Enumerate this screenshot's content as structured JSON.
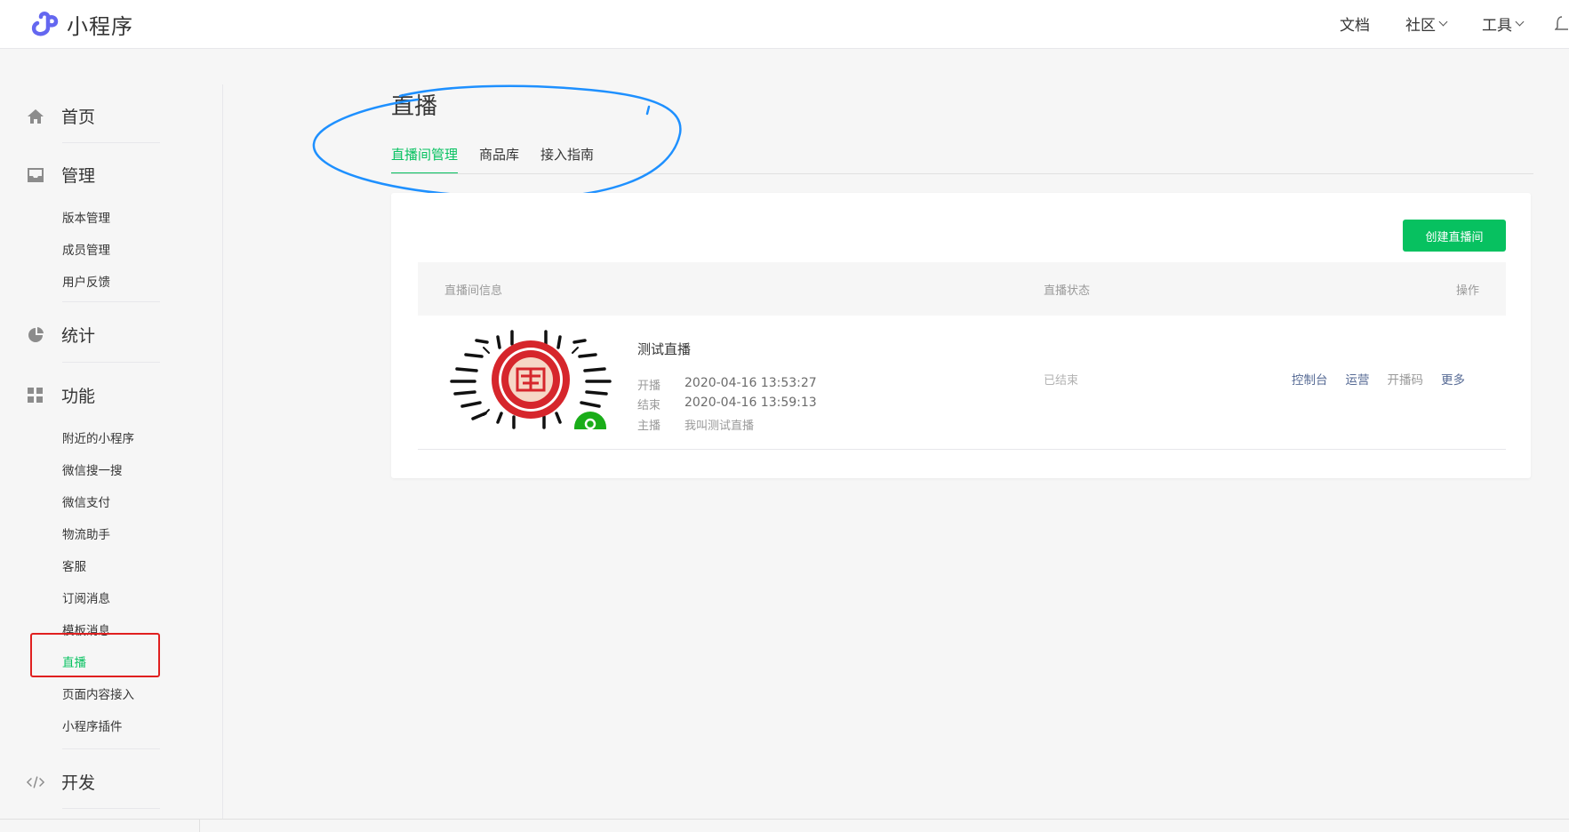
{
  "brand": {
    "name": "小程序",
    "color": "#6467f0"
  },
  "header": {
    "nav": [
      {
        "label": "文档",
        "dropdown": false
      },
      {
        "label": "社区",
        "dropdown": true
      },
      {
        "label": "工具",
        "dropdown": true
      }
    ],
    "notification_icon": "bell-icon"
  },
  "sidebar": {
    "groups": [
      {
        "label": "首页",
        "icon": "home-icon"
      },
      {
        "label": "管理",
        "icon": "inbox-icon",
        "items": [
          "版本管理",
          "成员管理",
          "用户反馈"
        ]
      },
      {
        "label": "统计",
        "icon": "pie-chart-icon"
      },
      {
        "label": "功能",
        "icon": "grid-icon",
        "items": [
          "附近的小程序",
          "微信搜一搜",
          "微信支付",
          "物流助手",
          "客服",
          "订阅消息",
          "模板消息",
          "直播",
          "页面内容接入",
          "小程序插件"
        ]
      },
      {
        "label": "开发",
        "icon": "code-icon"
      }
    ],
    "active_item": "直播"
  },
  "page": {
    "title": "直播",
    "tabs": [
      "直播间管理",
      "商品库",
      "接入指南"
    ],
    "active_tab": "直播间管理"
  },
  "card": {
    "create_button": "创建直播间",
    "columns": [
      "直播间信息",
      "直播状态",
      "操作"
    ],
    "rows": [
      {
        "title": "测试直播",
        "start_label": "开播",
        "start_time": "2020-04-16 13:53:27",
        "end_label": "结束",
        "end_time": "2020-04-16 13:59:13",
        "host_label": "主播",
        "host": "我叫测试直播",
        "status": "已结束",
        "actions": [
          "控制台",
          "运营",
          "开播码",
          "更多"
        ]
      }
    ]
  },
  "colors": {
    "accent": "#07c160",
    "link": "#576b95",
    "annotation_red": "#e02020",
    "annotation_blue": "#1e90ff"
  }
}
